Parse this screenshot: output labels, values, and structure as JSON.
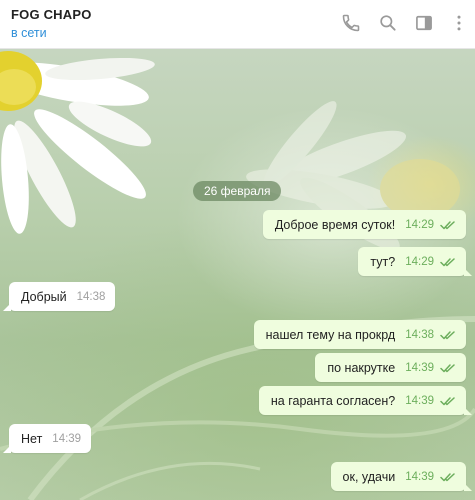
{
  "header": {
    "title": "FOG CHAPO",
    "status": "в сети",
    "icons": [
      "phone-icon",
      "search-icon",
      "sidebar-toggle-icon",
      "more-vertical-icon"
    ]
  },
  "date_divider": "26 февраля",
  "messages": [
    {
      "direction": "out",
      "text": "Доброе время суток!",
      "time": "14:29",
      "read": true
    },
    {
      "direction": "out",
      "text": "тут?",
      "time": "14:29",
      "read": true
    },
    {
      "direction": "in",
      "text": "Добрый",
      "time": "14:38"
    },
    {
      "direction": "out",
      "text": "нашел тему на прокрд",
      "time": "14:38",
      "read": true
    },
    {
      "direction": "out",
      "text": "по накрутке",
      "time": "14:39",
      "read": true
    },
    {
      "direction": "out",
      "text": "на гаранта согласен?",
      "time": "14:39",
      "read": true
    },
    {
      "direction": "in",
      "text": "Нет",
      "time": "14:39"
    },
    {
      "direction": "out",
      "text": "ок, удачи",
      "time": "14:39",
      "read": true
    }
  ],
  "colors": {
    "status_link": "#2f8fd8",
    "outgoing_bubble": "#effdde",
    "outgoing_time": "#6cae5c",
    "incoming_bubble": "#ffffff",
    "header_icons": "#9a9a9a"
  }
}
